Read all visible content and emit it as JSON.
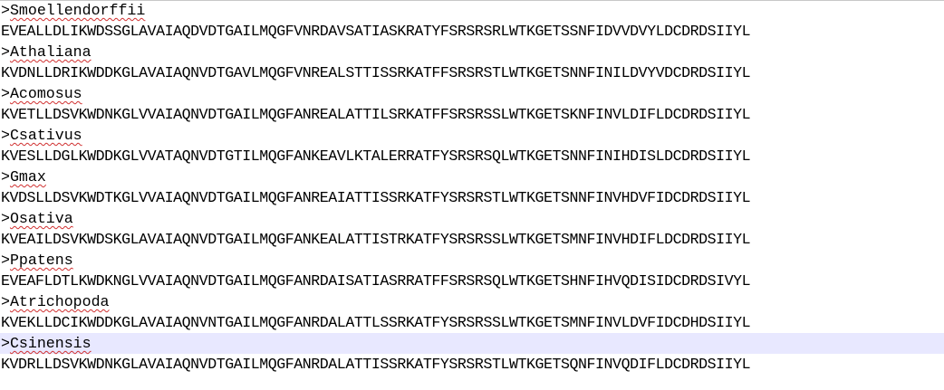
{
  "editor": {
    "current_line_color": "#e8e8ff",
    "spell_error_color": "#d03030",
    "records": [
      {
        "prefix": ">",
        "name": "Smoellendorffii",
        "sequence": "EVEALLDLIKWDSSGLAVAIAQDVDTGAILMQGFVNRDAVSATIASKRATYFSRSRSRLWTKGETSSNFIDVVDVYLDCDRDSIIYL"
      },
      {
        "prefix": ">",
        "name": "Athaliana",
        "sequence": "KVDNLLDRIKWDDKGLAVAIAQNVDTGAVLMQGFVNREALSTTISSRKATFFSRSRSTLWTKGETSNNFINILDVYVDCDRDSIIYL"
      },
      {
        "prefix": ">",
        "name": "Acomosus",
        "sequence": "KVETLLDSVKWDNKGLVVAIAQNVDTGAILMQGFANREALATTILSRKATFFSRSRSSLWTKGETSKNFINVLDIFLDCDRDSIIYL"
      },
      {
        "prefix": ">",
        "name": "Csativus",
        "sequence": "KVESLLDGLKWDDKGLVVATAQNVDTGTILMQGFANKEAVLKTALERRATFYSRSRSQLWTKGETSNNFINIHDISLDCDRDSIIYL"
      },
      {
        "prefix": ">",
        "name": "Gmax",
        "sequence": "KVDSLLDSVKWDTKGLVVAIAQNVDTGAILMQGFANREAIATTISSRKATFYSRSRSTLWTKGETSNNFINVHDVFIDCDRDSIIYL"
      },
      {
        "prefix": ">",
        "name": "Osativa",
        "sequence": "KVEAILDSVKWDSKGLAVAIAQNVDTGAILMQGFANKEALATTISTRKATFYSRSRSSLWTKGETSMNFINVHDIFLDCDRDSIIYL"
      },
      {
        "prefix": ">",
        "name": "Ppatens",
        "sequence": "EVEAFLDTLKWDKNGLVVAIAQNVDTGAILMQGFANRDAISATIASRRATFFSRSRSQLWTKGETSHNFIHVQDISIDCDRDSIVYL"
      },
      {
        "prefix": ">",
        "name": "Atrichopoda",
        "sequence": "KVEKLLDCIKWDDKGLAVAIAQNVNTGAILMQGFANRDALATTLSSRKATFYSRSRSSLWTKGETSMNFINVLDVFIDCDHDSIIYL"
      },
      {
        "prefix": ">",
        "name": "Csinensis",
        "sequence": "KVDRLLDSVKWDNKGLAVAIAQNVDTGAILMQGFANRDALATTISSRKATFYSRSRSTLWTKGETSQNFINVQDIFLDCDRDSIIYL"
      }
    ]
  }
}
